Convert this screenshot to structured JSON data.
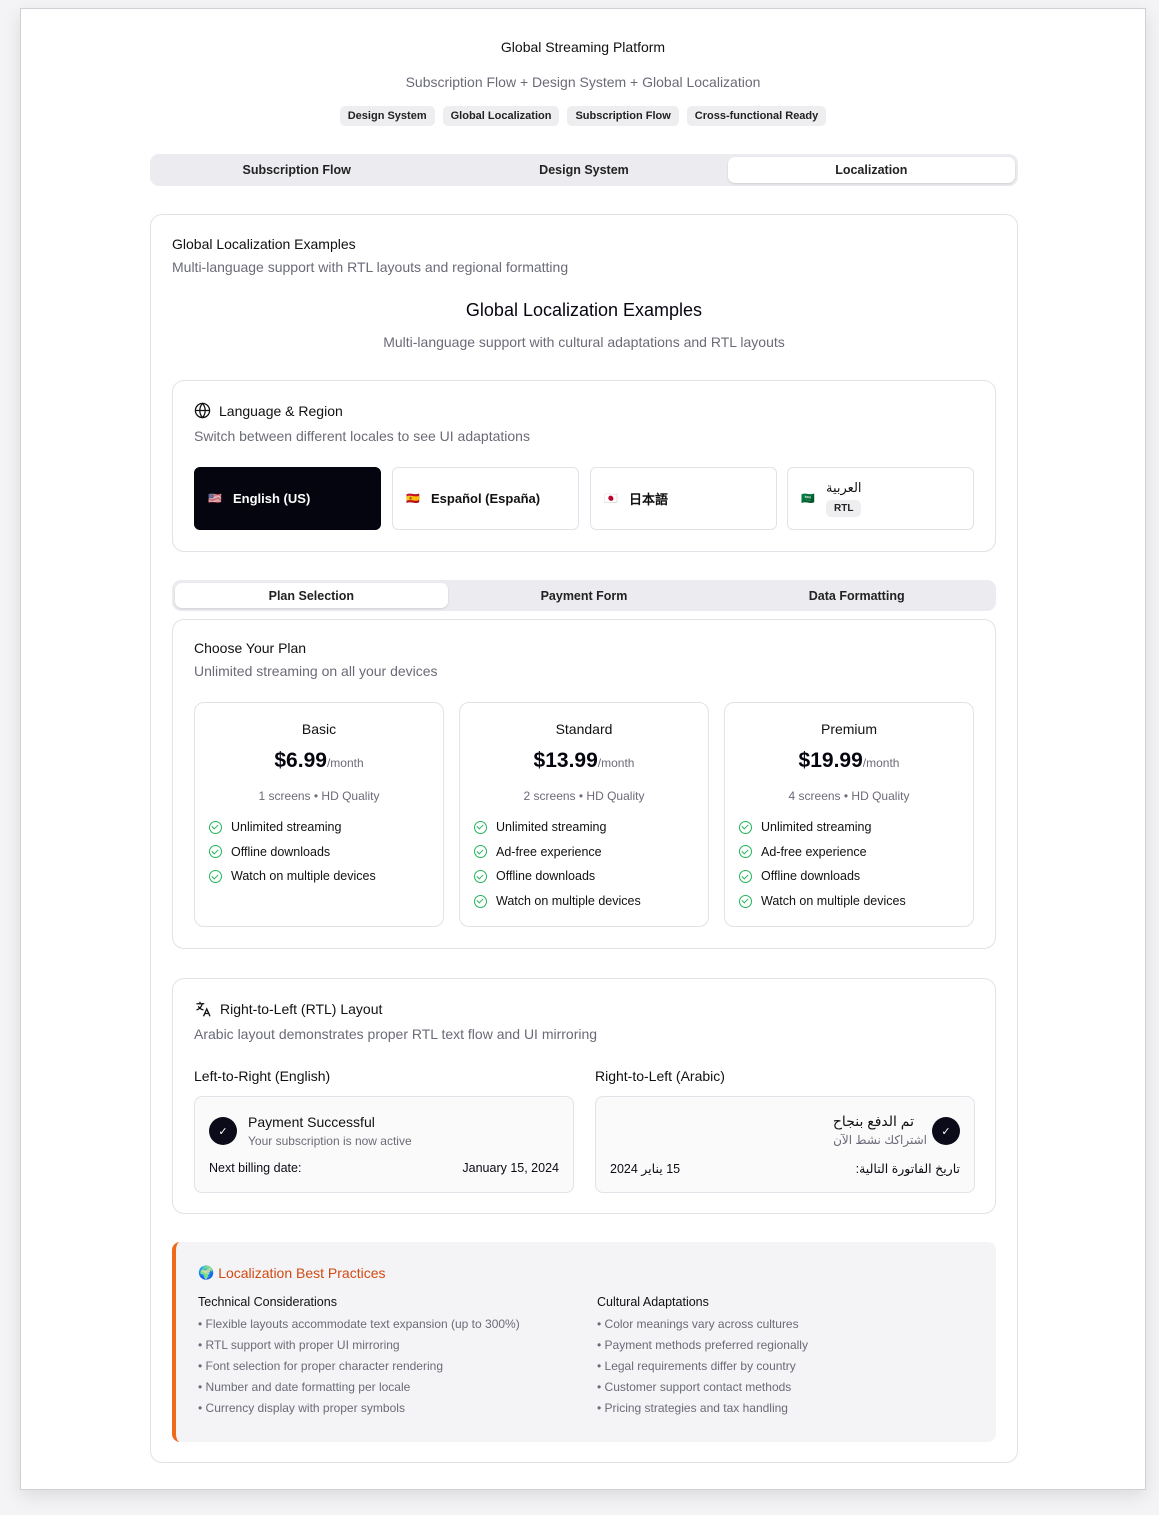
{
  "header": {
    "title": "Global Streaming Platform",
    "subtitle": "Subscription Flow + Design System + Global Localization",
    "badges": [
      "Design System",
      "Global Localization",
      "Subscription Flow",
      "Cross-functional Ready"
    ]
  },
  "main_tabs": [
    "Subscription Flow",
    "Design System",
    "Localization"
  ],
  "main_tabs_active": "Localization",
  "section": {
    "title": "Global Localization Examples",
    "subtitle": "Multi-language support with RTL layouts and regional formatting",
    "heading": "Global Localization Examples",
    "heading_sub": "Multi-language support with cultural adaptations and RTL layouts"
  },
  "language": {
    "title": "Language & Region",
    "subtitle": "Switch between different locales to see UI adaptations",
    "icon": "globe-icon",
    "locales": [
      {
        "flag": "🇺🇸",
        "label": "English (US)",
        "active": true
      },
      {
        "flag": "🇪🇸",
        "label": "Español (España)",
        "active": false
      },
      {
        "flag": "🇯🇵",
        "label": "日本語",
        "active": false
      },
      {
        "flag": "🇸🇦",
        "label": "العربية",
        "tag": "RTL",
        "active": false
      }
    ]
  },
  "sub_tabs": [
    "Plan Selection",
    "Payment Form",
    "Data Formatting"
  ],
  "sub_tabs_active": "Plan Selection",
  "plans": {
    "title": "Choose Your Plan",
    "subtitle": "Unlimited streaming on all your devices",
    "per": "/month",
    "items": [
      {
        "name": "Basic",
        "price": "$6.99",
        "meta": "1 screens • HD Quality",
        "features": [
          "Unlimited streaming",
          "Offline downloads",
          "Watch on multiple devices"
        ]
      },
      {
        "name": "Standard",
        "price": "$13.99",
        "meta": "2 screens • HD Quality",
        "features": [
          "Unlimited streaming",
          "Ad-free experience",
          "Offline downloads",
          "Watch on multiple devices"
        ]
      },
      {
        "name": "Premium",
        "price": "$19.99",
        "meta": "4 screens • HD Quality",
        "features": [
          "Unlimited streaming",
          "Ad-free experience",
          "Offline downloads",
          "Watch on multiple devices"
        ]
      }
    ]
  },
  "rtl": {
    "title": "Right-to-Left (RTL) Layout",
    "subtitle": "Arabic layout demonstrates proper RTL text flow and UI mirroring",
    "icon": "translate-icon",
    "ltr_label": "Left-to-Right (English)",
    "rtl_label": "Right-to-Left (Arabic)",
    "ltr": {
      "title": "Payment Successful",
      "sub": "Your subscription is now active",
      "billing_label": "Next billing date:",
      "billing_value": "January 15, 2024"
    },
    "ar": {
      "title": "تم الدفع بنجاح",
      "sub": "اشتراكك نشط الآن",
      "billing_label": "تاريخ الفاتورة التالية:",
      "billing_value": "15 يناير 2024"
    }
  },
  "best_practices": {
    "title": "Localization Best Practices",
    "icon": "earth-icon",
    "accent": "#f0691a",
    "technical": {
      "title": "Technical Considerations",
      "items": [
        "• Flexible layouts accommodate text expansion (up to 300%)",
        "• RTL support with proper UI mirroring",
        "• Font selection for proper character rendering",
        "• Number and date formatting per locale",
        "• Currency display with proper symbols"
      ]
    },
    "cultural": {
      "title": "Cultural Adaptations",
      "items": [
        "• Color meanings vary across cultures",
        "• Payment methods preferred regionally",
        "• Legal requirements differ by country",
        "• Customer support contact methods",
        "• Pricing strategies and tax handling"
      ]
    }
  }
}
